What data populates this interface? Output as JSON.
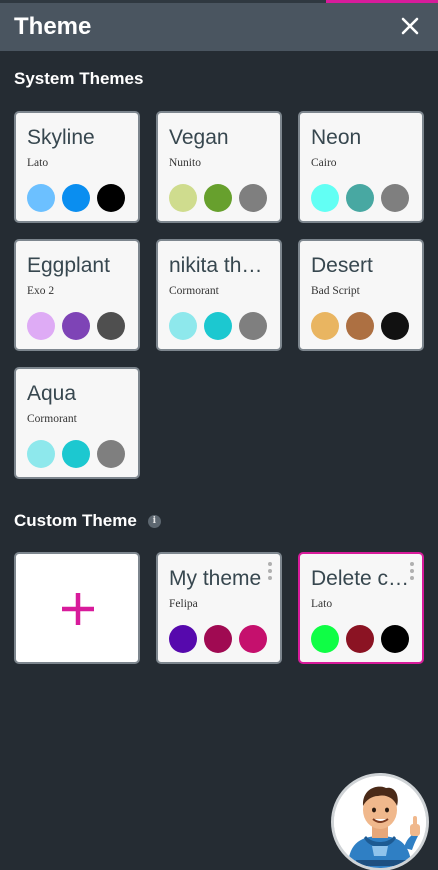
{
  "header": {
    "title": "Theme"
  },
  "system_section": {
    "title": "System Themes"
  },
  "custom_section": {
    "title": "Custom Theme"
  },
  "system_themes": [
    {
      "name": "Skyline",
      "font": "Lato",
      "colors": [
        "#6cc0ff",
        "#0a8ef0",
        "#000000"
      ]
    },
    {
      "name": "Vegan",
      "font": "Nunito",
      "colors": [
        "#cfdc8e",
        "#67a02d",
        "#7f7f7f"
      ]
    },
    {
      "name": "Neon",
      "font": "Cairo",
      "colors": [
        "#62fff4",
        "#48a8a2",
        "#7f7f7f"
      ]
    },
    {
      "name": "Eggplant",
      "font": "Exo 2",
      "colors": [
        "#deabf5",
        "#7e44b6",
        "#4f4f4f"
      ]
    },
    {
      "name": "nikita theme",
      "font": "Cormorant",
      "colors": [
        "#8ee8ec",
        "#1cc8d0",
        "#7f7f7f"
      ]
    },
    {
      "name": "Desert",
      "font": "Bad Script",
      "colors": [
        "#e9b561",
        "#ad7042",
        "#111111"
      ]
    },
    {
      "name": "Aqua",
      "font": "Cormorant",
      "colors": [
        "#8ee8ec",
        "#1cc8d0",
        "#7f7f7f"
      ]
    }
  ],
  "custom_themes": [
    {
      "name": "My theme",
      "font": "Felipa",
      "colors": [
        "#5609ad",
        "#a00a52",
        "#c5106d"
      ]
    },
    {
      "name": "Delete custom theme",
      "font": "Lato",
      "colors": [
        "#0ffe45",
        "#8b1323",
        "#000000"
      ]
    }
  ],
  "accent_color": "#d81b9b",
  "icons": {
    "close": "close-icon",
    "info": "info-icon",
    "add": "plus-icon",
    "menu": "kebab-menu-icon",
    "avatar": "mascot-avatar"
  },
  "info_glyph": "i"
}
